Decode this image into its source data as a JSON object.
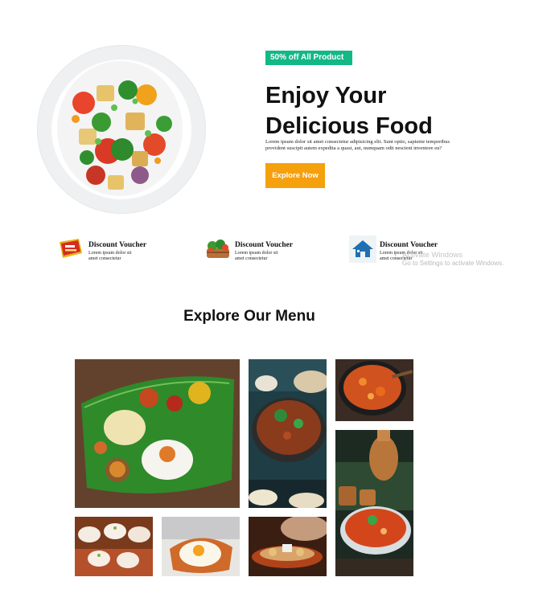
{
  "hero": {
    "badge": "50% off All Product",
    "title_line1": "Enjoy Your",
    "title_line2": "Delicious Food",
    "description": "Lorem ipsum dolor sit amet consectetur adipisicing elit. Sunt optio, sapiente temporibus provident suscipit autem expedita a quasi, aut, numquam odit nescient inventore eu?",
    "cta_label": "Explore Now"
  },
  "vouchers": [
    {
      "title": "Discount Voucher",
      "text": "Lorem ipsum dolor sit amet consectetur",
      "icon": "outlet-tag-icon"
    },
    {
      "title": "Discount Voucher",
      "text": "Lorem ipsum dolor sit amet consectetur",
      "icon": "vegetable-basket-icon"
    },
    {
      "title": "Discount Voucher",
      "text": "Lorem ipsum dolor sit amet consectetur",
      "icon": "house-icon"
    }
  ],
  "watermark": {
    "line1": "Activate Windows",
    "line2": "Go to Settings to activate Windows."
  },
  "menu": {
    "title": "Explore Our Menu",
    "tiles": [
      {
        "name": "banana-leaf-meal"
      },
      {
        "name": "curry-bowl"
      },
      {
        "name": "spicy-fries"
      },
      {
        "name": "copper-pot-curry"
      },
      {
        "name": "cupcakes"
      },
      {
        "name": "egg-toast"
      },
      {
        "name": "snack-plate"
      }
    ]
  },
  "colors": {
    "accent_green": "#12b886",
    "accent_orange": "#f5a00d"
  }
}
